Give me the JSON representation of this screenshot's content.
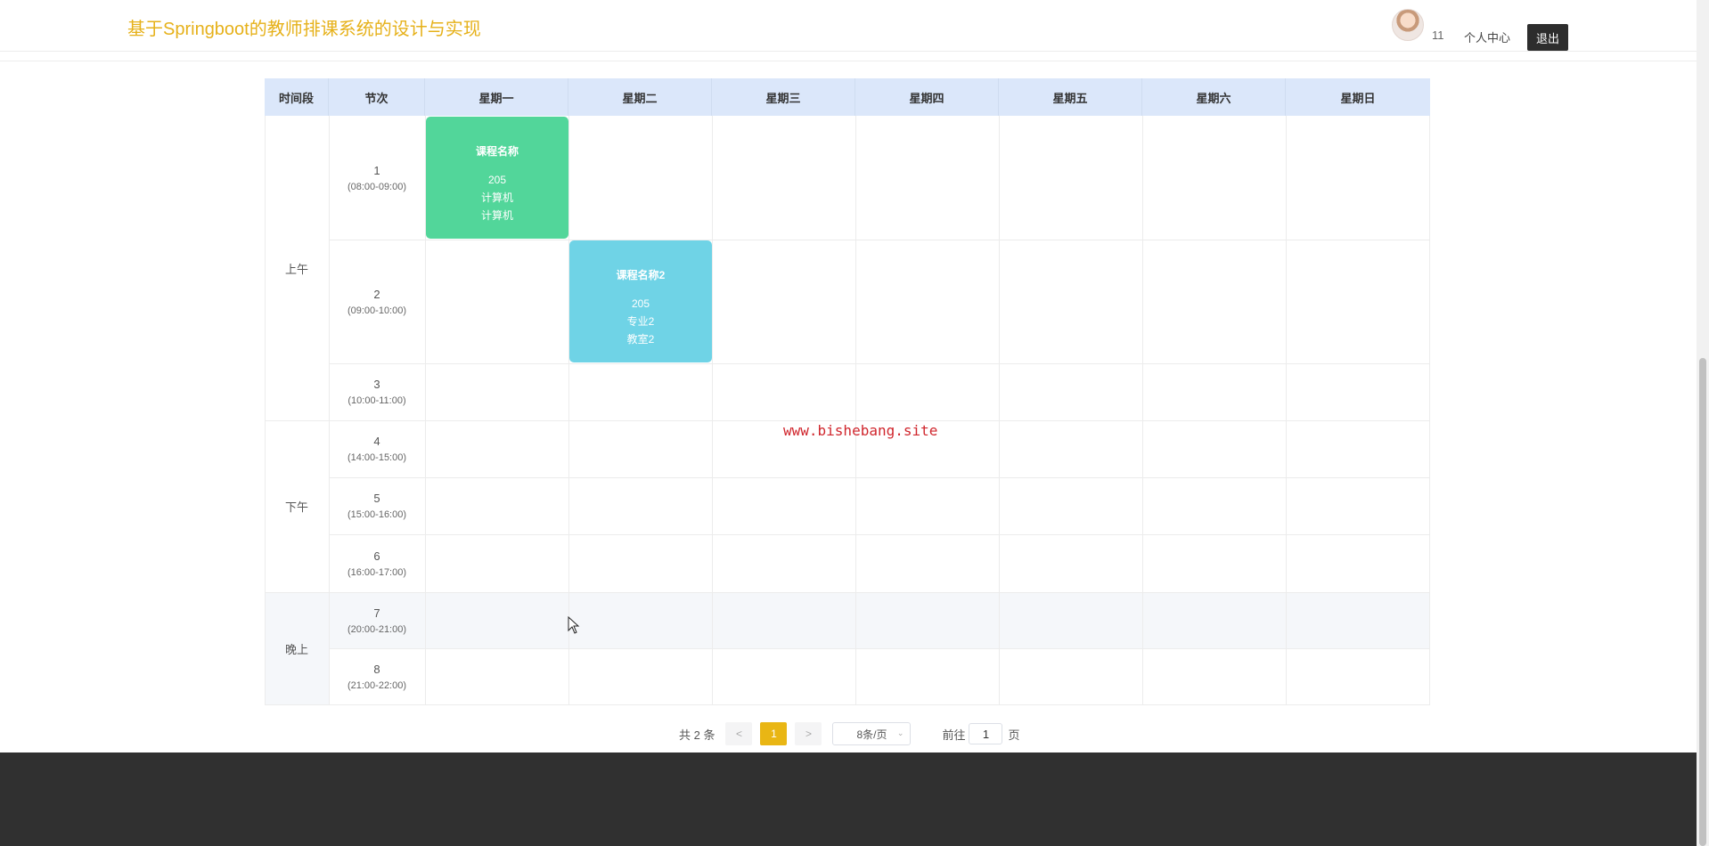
{
  "header": {
    "site_title": "基于Springboot的教师排课系统的设计与实现",
    "user_name": "11",
    "profile_link": "个人中心",
    "logout_label": "退出"
  },
  "timetable": {
    "columns": [
      "时间段",
      "节次",
      "星期一",
      "星期二",
      "星期三",
      "星期四",
      "星期五",
      "星期六",
      "星期日"
    ],
    "periods": [
      "上午",
      "下午",
      "晚上"
    ],
    "slots": [
      {
        "num": "1",
        "time": "(08:00-09:00)"
      },
      {
        "num": "2",
        "time": "(09:00-10:00)"
      },
      {
        "num": "3",
        "time": "(10:00-11:00)"
      },
      {
        "num": "4",
        "time": "(14:00-15:00)"
      },
      {
        "num": "5",
        "time": "(15:00-16:00)"
      },
      {
        "num": "6",
        "time": "(16:00-17:00)"
      },
      {
        "num": "7",
        "time": "(20:00-21:00)"
      },
      {
        "num": "8",
        "time": "(21:00-22:00)"
      }
    ],
    "courses": [
      {
        "name": "课程名称",
        "room": "205",
        "line2": "计算机",
        "line3": "计算机",
        "day": "星期一",
        "slot": "1",
        "color": "#52d69a"
      },
      {
        "name": "课程名称2",
        "room": "205",
        "line2": "专业2",
        "line3": "教室2",
        "day": "星期二",
        "slot": "2",
        "color": "#6fd3e6"
      }
    ]
  },
  "watermark": "www.bishebang.site",
  "pagination": {
    "total_label": "共 2 条",
    "prev": "<",
    "current_page": "1",
    "next": ">",
    "page_size": "8条/页",
    "goto_prefix": "前往",
    "goto_value": "1",
    "goto_suffix": "页"
  },
  "colors": {
    "title": "#e6b11a",
    "header_bg": "#dbe7fa",
    "active_page": "#e9b614",
    "footer": "#303030"
  }
}
